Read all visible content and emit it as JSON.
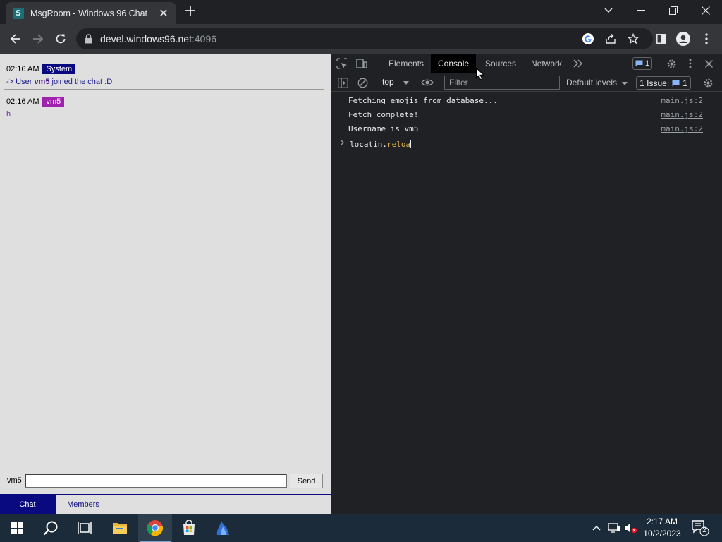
{
  "browser": {
    "tab_title": "MsgRoom - Windows 96 Chat",
    "tab_favicon_letter": "S",
    "url_host": "devel.windows96.net",
    "url_port": ":4096"
  },
  "chat": {
    "messages": [
      {
        "time": "02:16 AM",
        "author": "System",
        "text_prefix": "-> User ",
        "text_user": "vm5",
        "text_suffix": " joined the chat :D"
      },
      {
        "time": "02:16 AM",
        "author": "vm5",
        "text": "h"
      }
    ],
    "input_label": "vm5",
    "input_value": "",
    "send_label": "Send",
    "tabs": [
      "Chat",
      "Members"
    ]
  },
  "devtools": {
    "tabs": [
      "Elements",
      "Console",
      "Sources",
      "Network"
    ],
    "active_tab": "Console",
    "message_count": "1",
    "context": "top",
    "filter_placeholder": "Filter",
    "levels": "Default levels",
    "issues_label": "1 Issue:",
    "issues_count": "1",
    "logs": [
      {
        "text": "Fetching emojis from database...",
        "source": "main.js:2"
      },
      {
        "text": "Fetch complete!",
        "source": "main.js:2"
      },
      {
        "text": "Username is vm5",
        "source": "main.js:2"
      }
    ],
    "prompt_object": "locatin.",
    "prompt_prop": "reloa"
  },
  "taskbar": {
    "time": "2:17 AM",
    "date": "10/2/2023",
    "notification_count": "2"
  },
  "colors": {
    "system_badge": "#0a0a80",
    "user_badge": "#a020b0",
    "devtools_bg": "#202124",
    "taskbar_bg": "#1c2b39"
  }
}
